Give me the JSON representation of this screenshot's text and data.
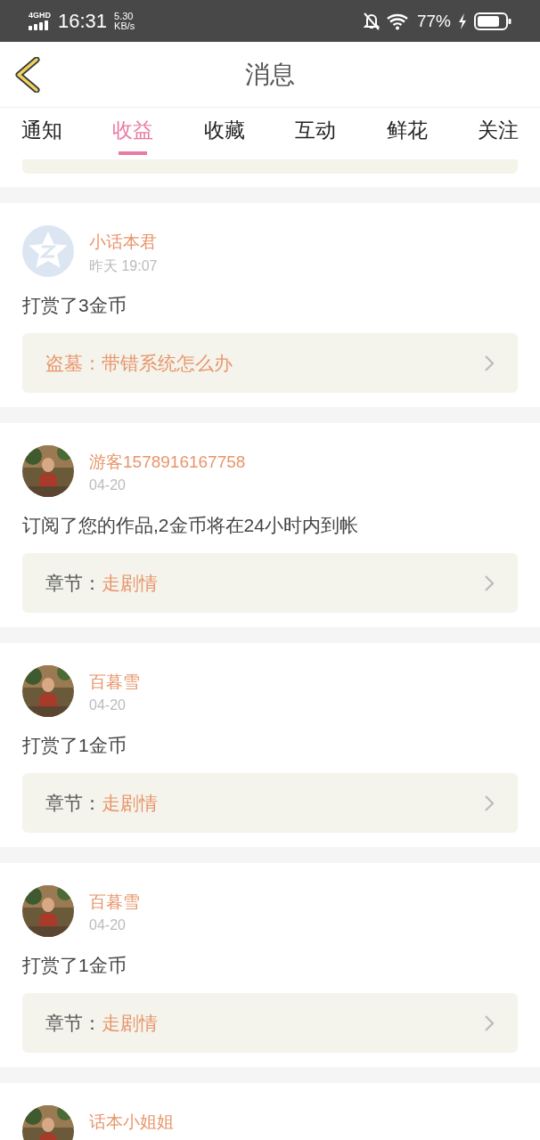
{
  "status_bar": {
    "network": "4GHD",
    "time": "16:31",
    "speed_value": "5.30",
    "speed_unit": "KB/s",
    "battery": "77%",
    "charging": true
  },
  "header": {
    "title": "消息"
  },
  "tabs": [
    {
      "label": "通知",
      "selected": false
    },
    {
      "label": "收益",
      "selected": true
    },
    {
      "label": "收藏",
      "selected": false
    },
    {
      "label": "互动",
      "selected": false
    },
    {
      "label": "鲜花",
      "selected": false
    },
    {
      "label": "关注",
      "selected": false
    }
  ],
  "messages": [
    {
      "avatar": {
        "kind": "default"
      },
      "name": "小话本君",
      "time": "昨天 19:07",
      "text": "打赏了3金币",
      "link": {
        "label": "盗墓：",
        "label_highlighted": true,
        "title": "带错系统怎么办"
      }
    },
    {
      "name": "游客1578916167758",
      "time": "04-20",
      "text": "订阅了您的作品,2金币将在24小时内到帐",
      "link": {
        "label": "章节：",
        "label_highlighted": false,
        "title": "走剧情"
      }
    },
    {
      "name": "百暮雪",
      "time": "04-20",
      "text": "打赏了1金币",
      "link": {
        "label": "章节：",
        "label_highlighted": false,
        "title": "走剧情"
      }
    },
    {
      "name": "百暮雪",
      "time": "04-20",
      "text": "打赏了1金币",
      "link": {
        "label": "章节：",
        "label_highlighted": false,
        "title": "走剧情"
      }
    },
    {
      "name": "话本小姐姐"
    }
  ]
}
